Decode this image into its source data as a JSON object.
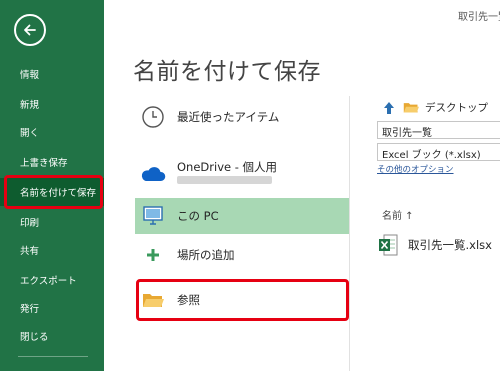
{
  "window_title": "取引先一覧",
  "page_title": "名前を付けて保存",
  "nav": {
    "items": [
      "情報",
      "新規",
      "開く",
      "上書き保存",
      "名前を付けて保存",
      "印刷",
      "共有",
      "エクスポート",
      "発行",
      "閉じる"
    ],
    "active_index": 4
  },
  "locations": {
    "recent": "最近使ったアイテム",
    "onedrive": "OneDrive - 個人用",
    "this_pc": "この PC",
    "add_place": "場所の追加",
    "browse": "参照"
  },
  "right_panel": {
    "folder": "デスクトップ",
    "filename": "取引先一覧",
    "filetype": "Excel ブック (*.xlsx)",
    "more_options": "その他のオプション",
    "name_column": "名前 ↑",
    "files": [
      "取引先一覧.xlsx"
    ]
  },
  "colors": {
    "sidebar": "#217346",
    "sidebar_active": "#0e5c2f",
    "selected_location": "#a8d8b4",
    "highlight": "#e60012",
    "link": "#2b579a"
  },
  "icons": {
    "back": "back-arrow-icon",
    "recent": "clock-icon",
    "onedrive": "cloud-icon",
    "this_pc": "computer-icon",
    "add_place": "plus-icon",
    "browse": "folder-icon",
    "up": "up-arrow-icon",
    "file": "excel-file-icon"
  }
}
